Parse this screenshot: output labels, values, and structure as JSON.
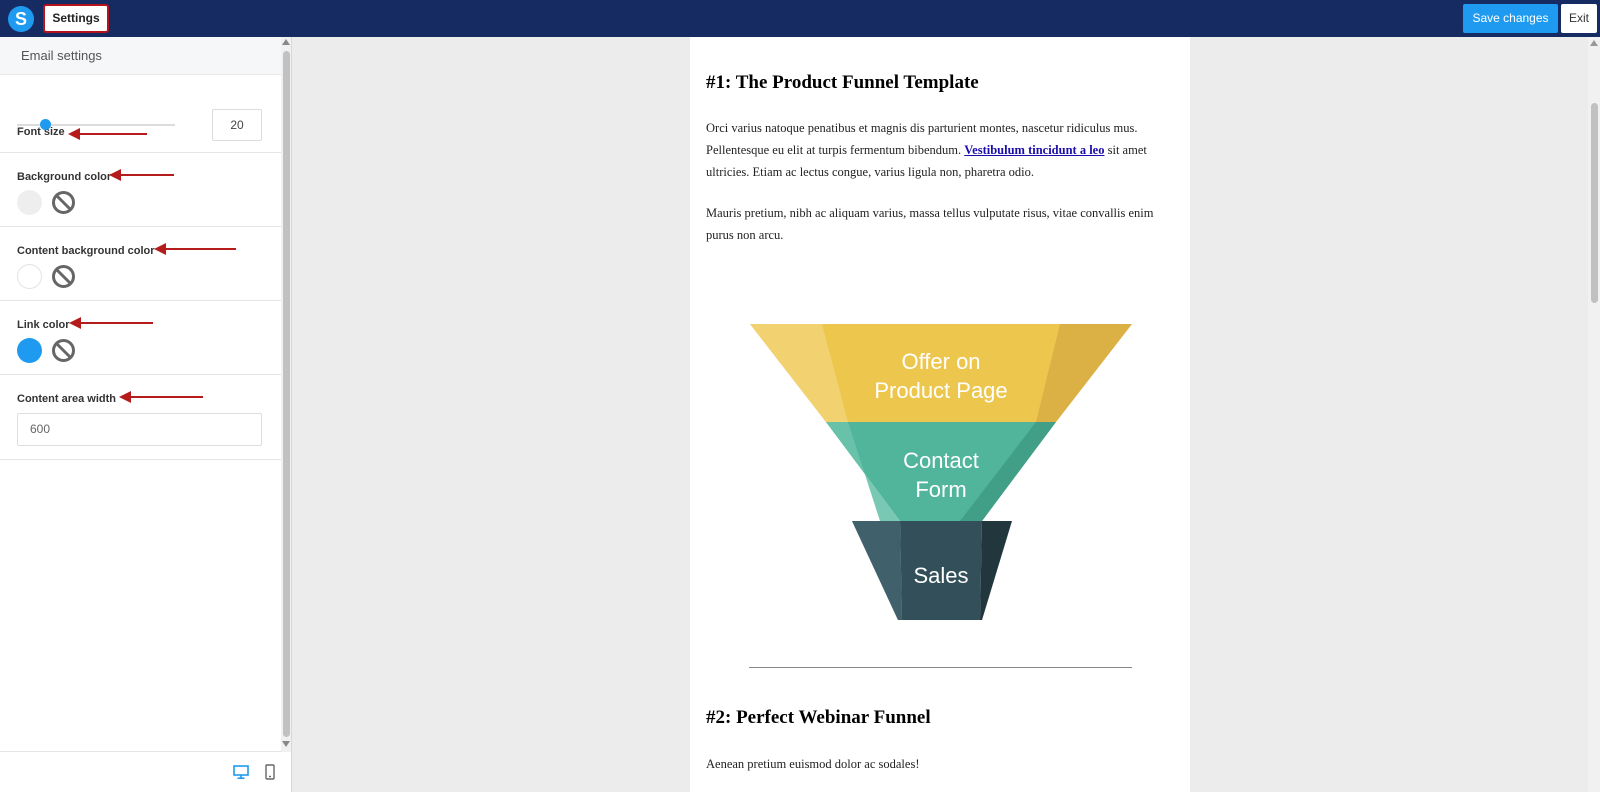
{
  "topbar": {
    "logo_letter": "S",
    "settings_tab": "Settings",
    "save_button": "Save changes",
    "exit_button": "Exit"
  },
  "sidebar": {
    "header": "Email settings",
    "font_size": {
      "label": "Font size",
      "value": "20",
      "slider_fraction": 0.18
    },
    "background_color": {
      "label": "Background color",
      "color": "#eeeeee"
    },
    "content_background_color": {
      "label": "Content background color",
      "color": "#ffffff"
    },
    "link_color": {
      "label": "Link color",
      "color": "#1e9bf0"
    },
    "content_area_width": {
      "label": "Content area width",
      "value": "600"
    },
    "footer": {
      "desktop_icon": "desktop-icon",
      "mobile_icon": "mobile-icon"
    }
  },
  "email": {
    "heading1": "#1: The Product Funnel Template",
    "para1_text": "Orci varius natoque penatibus et magnis dis parturient montes, nascetur ridiculus mus. Pellentesque eu elit at turpis fermentum bibendum.",
    "para1_link": "Vestibulum tincidunt a leo",
    "para1_tail": "sit amet ultricies. Etiam ac lectus congue, varius ligula non, pharetra odio.",
    "para2": "Mauris pretium, nibh ac aliquam varius, massa tellus vulputate risus, vitae convallis enim purus non arcu.",
    "funnel": {
      "top_line1": "Offer on",
      "top_line2": "Product Page",
      "middle_line1": "Contact",
      "middle_line2": "Form",
      "bottom": "Sales"
    },
    "heading2": "#2: Perfect Webinar Funnel",
    "para3": "Aenean pretium euismod dolor ac sodales!"
  },
  "colors": {
    "topbar": "#172b63",
    "accent": "#1e9bf0",
    "annotation_arrow": "#b51b1b",
    "funnel_yellow": "#edc64e",
    "funnel_teal": "#51b59c",
    "funnel_dark": "#33505a"
  }
}
